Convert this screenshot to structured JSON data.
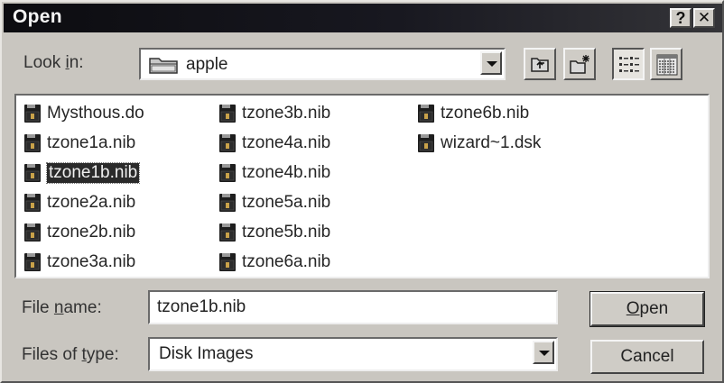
{
  "window": {
    "title": "Open",
    "help_label": "?",
    "close_label": "✕"
  },
  "look_in": {
    "label_prefix": "Look ",
    "label_key": "i",
    "label_suffix": "n:",
    "value": "apple"
  },
  "toolbar": [
    {
      "name": "up-one-level-icon"
    },
    {
      "name": "new-folder-icon"
    },
    {
      "name": "list-view-icon",
      "pressed": true
    },
    {
      "name": "details-view-icon"
    }
  ],
  "files": [
    {
      "name": "Mysthous.do",
      "icon": "disk-image-icon"
    },
    {
      "name": "tzone1a.nib",
      "icon": "disk-image-icon"
    },
    {
      "name": "tzone1b.nib",
      "icon": "disk-image-icon",
      "selected": true
    },
    {
      "name": "tzone2a.nib",
      "icon": "disk-image-icon"
    },
    {
      "name": "tzone2b.nib",
      "icon": "disk-image-icon"
    },
    {
      "name": "tzone3a.nib",
      "icon": "disk-image-icon"
    },
    {
      "name": "tzone3b.nib",
      "icon": "disk-image-icon"
    },
    {
      "name": "tzone4a.nib",
      "icon": "disk-image-icon"
    },
    {
      "name": "tzone4b.nib",
      "icon": "disk-image-icon"
    },
    {
      "name": "tzone5a.nib",
      "icon": "disk-image-icon"
    },
    {
      "name": "tzone5b.nib",
      "icon": "disk-image-icon"
    },
    {
      "name": "tzone6a.nib",
      "icon": "disk-image-icon"
    },
    {
      "name": "tzone6b.nib",
      "icon": "disk-image-icon"
    },
    {
      "name": "wizard~1.dsk",
      "icon": "disk-image-icon"
    }
  ],
  "file_name": {
    "label_prefix": "File ",
    "label_key": "n",
    "label_suffix": "ame:",
    "value": "tzone1b.nib"
  },
  "file_type": {
    "label_prefix": "Files of ",
    "label_key": "t",
    "label_suffix": "ype:",
    "value": "Disk Images"
  },
  "buttons": {
    "open_key": "O",
    "open_rest": "pen",
    "cancel": "Cancel"
  }
}
